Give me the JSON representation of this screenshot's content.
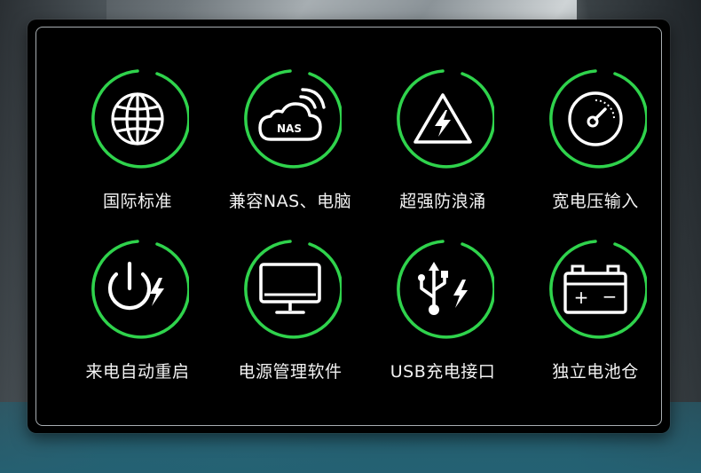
{
  "theme": {
    "panel_bg": "#000000",
    "ring_color": "#2fd34c",
    "icon_color": "#ffffff",
    "label_color": "#f2f2f2"
  },
  "features": [
    {
      "label": "国际标准",
      "icon": "globe-icon"
    },
    {
      "label": "兼容NAS、电脑",
      "icon": "nas-cloud-icon",
      "icon_text": "NAS"
    },
    {
      "label": "超强防浪涌",
      "icon": "surge-warning-icon"
    },
    {
      "label": "宽电压输入",
      "icon": "gauge-icon"
    },
    {
      "label": "来电自动重启",
      "icon": "power-restart-icon"
    },
    {
      "label": "电源管理软件",
      "icon": "monitor-icon"
    },
    {
      "label": "USB充电接口",
      "icon": "usb-charge-icon"
    },
    {
      "label": "独立电池仓",
      "icon": "battery-icon",
      "icon_text_plus": "+",
      "icon_text_minus": "−"
    }
  ]
}
